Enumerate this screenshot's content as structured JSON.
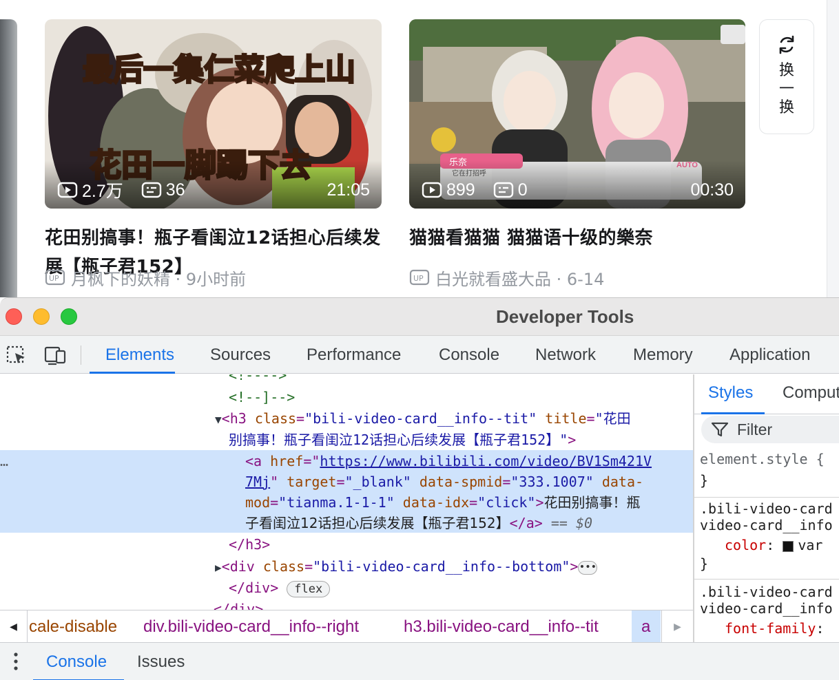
{
  "page": {
    "cards": [
      {
        "thumb_title_text_1": "最后一集仁菜爬上山",
        "thumb_title_text_2": "花田一脚踢下去",
        "views": "2.7万",
        "danmaku": "36",
        "duration": "21:05",
        "title": "花田别搞事！瓶子看闺泣12话担心后续发展【瓶子君152】",
        "owner": "月枫下的妖精 · 9小时前"
      },
      {
        "thumb_chip_name": "乐奈",
        "thumb_chip_sub": "它在打招呼",
        "thumb_auto": "AUTO",
        "views": "899",
        "danmaku": "0",
        "duration": "00:30",
        "title": "猫猫看猫猫 猫猫语十级的樂奈",
        "owner": "白光就看盛大品 · 6-14"
      }
    ],
    "refresh": {
      "c1": "换",
      "c2": "一",
      "c3": "换"
    }
  },
  "devtools": {
    "window_title": "Developer Tools",
    "tabs": [
      "Elements",
      "Sources",
      "Performance",
      "Console",
      "Network",
      "Memory",
      "Application"
    ],
    "active_tab": "Elements",
    "dom": {
      "l0": "<!---->",
      "l1": "<!--]-->",
      "h3_tag": "h3",
      "h3_class_attr": "class",
      "h3_class_val": "\"bili-video-card__info--tit\"",
      "h3_title_attr": "title",
      "h3_title_val_1": "\"花田",
      "h3_title_val_2": "别搞事！瓶子看闺泣12话担心后续发展【瓶子君152】\"",
      "a_tag": "a",
      "a_href_attr": "href",
      "a_href_1": "https://www.bilibili.com/video/BV1Sm421V",
      "a_href_2": "7Mj",
      "a_target_attr": "target",
      "a_target_val": "\"_blank\"",
      "a_spmid_attr": "data-spmid",
      "a_spmid_val": "\"333.1007\"",
      "a_mod_attr_1": "data-",
      "a_mod_attr_2": "mod",
      "a_mod_val": "\"tianma.1-1-1\"",
      "a_idx_attr": "data-idx",
      "a_idx_val": "\"click\"",
      "a_text_1": "花田别搞事！瓶",
      "a_text_2": "子看闺泣12话担心后续发展【瓶子君152】",
      "a_eq": "== $0",
      "h3_close": "</h3>",
      "div_tag": "div",
      "div_class_val": "\"bili-video-card__info--bottom\"",
      "div_close": "</div>",
      "flex_badge": "flex",
      "partial": "</div>"
    },
    "breadcrumbs": [
      "cale-disable",
      "div.bili-video-card__info--right",
      "h3.bili-video-card__info--tit",
      "a"
    ],
    "styles": {
      "tabs": [
        "Styles",
        "Comput"
      ],
      "filter_placeholder": "Filter",
      "element_style": "element.style {",
      "close_brace": "}",
      "rule1_sel_1": ".bili-video-card",
      "rule1_sel_2": "video-card__info",
      "rule1_prop": "color",
      "rule1_val": "var",
      "rule2_sel_1": ".bili-video-card",
      "rule2_sel_2": "video-card__info",
      "rule2_prop": "font-family"
    },
    "drawer_tabs": [
      "Console",
      "Issues"
    ]
  },
  "colors": {
    "accent": "#1a73e8",
    "selection": "#cfe3fc"
  }
}
